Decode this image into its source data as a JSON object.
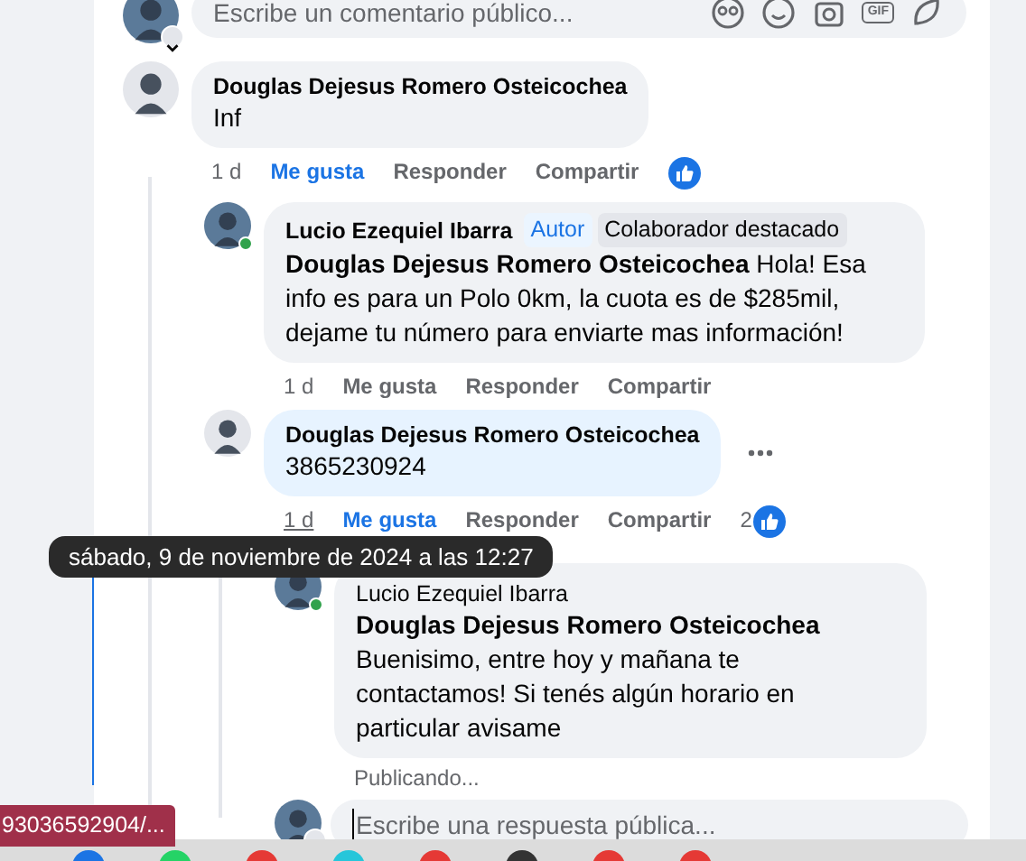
{
  "composer": {
    "placeholder": "Escribe un comentario público...",
    "gif_label": "GIF"
  },
  "comments": [
    {
      "author": "Douglas Dejesus Romero Osteicochea",
      "text": "Inf",
      "time": "1 d",
      "time_hovered": false,
      "like_label": "Me gusta",
      "liked": true,
      "reply_label": "Responder",
      "share_label": "Compartir",
      "reaction_icon": true,
      "replies": [
        {
          "author": "Lucio Ezequiel Ibarra",
          "online": true,
          "badges": [
            {
              "label": "Autor",
              "kind": "author"
            },
            {
              "label": "Colaborador destacado",
              "kind": "top"
            }
          ],
          "mention": "Douglas Dejesus Romero Osteicochea",
          "text": "Hola! Esa info es para un Polo 0km, la cuota es de $285mil, dejame tu número para enviarte mas información!",
          "time": "1 d",
          "time_hovered": false,
          "like_label": "Me gusta",
          "liked": false,
          "reply_label": "Responder",
          "share_label": "Compartir"
        },
        {
          "author": "Douglas Dejesus Romero Osteicochea",
          "highlighted": true,
          "show_menu": true,
          "text": "3865230924",
          "time": "1 d",
          "time_hovered": true,
          "like_label": "Me gusta",
          "liked": true,
          "reply_label": "Responder",
          "share_label": "Compartir",
          "reaction_icon": true,
          "reaction_count": "2",
          "replies": [
            {
              "author": "Lucio Ezequiel Ibarra",
              "online": true,
              "mention": "Douglas Dejesus Romero Osteicochea",
              "text": "Buenisimo, entre hoy y mañana te contactamos! Si tenés algún horario en particular avisame",
              "status": "Publicando..."
            }
          ],
          "reply_box": {
            "placeholder": "Escribe una respuesta pública..."
          }
        }
      ]
    }
  ],
  "tooltip": "sábado, 9 de noviembre de 2024 a las 12:27",
  "status_url": "93036592904/..."
}
